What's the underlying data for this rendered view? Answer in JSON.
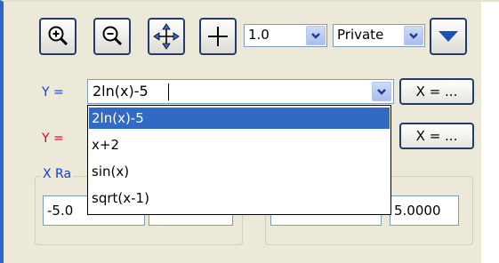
{
  "toolbar": {
    "zoom_in_icon": "zoom-in-icon",
    "zoom_out_icon": "zoom-out-icon",
    "pan_icon": "pan-arrows-icon",
    "crosshair_icon": "crosshair-icon",
    "scale_value": "1.0",
    "visibility_value": "Private"
  },
  "functions": [
    {
      "label": "Y =",
      "value": "2ln(x)-5",
      "color": "#0b3fe0"
    },
    {
      "label": "Y =",
      "color": "#e0001b"
    }
  ],
  "x_button_label": "X = ...",
  "x_range": {
    "title": "X Ra",
    "min": "-5.0",
    "max_fragment": ""
  },
  "y_range": {
    "min_fragment": "",
    "max": "5.0000"
  },
  "dropdown": {
    "options": [
      "2ln(x)-5",
      "x+2",
      "sin(x)",
      "sqrt(x-1)"
    ],
    "selected_index": 0
  },
  "colors": {
    "accent": "#316ac5",
    "window_bg": "#ece9d8",
    "button_border": "#233c70"
  }
}
